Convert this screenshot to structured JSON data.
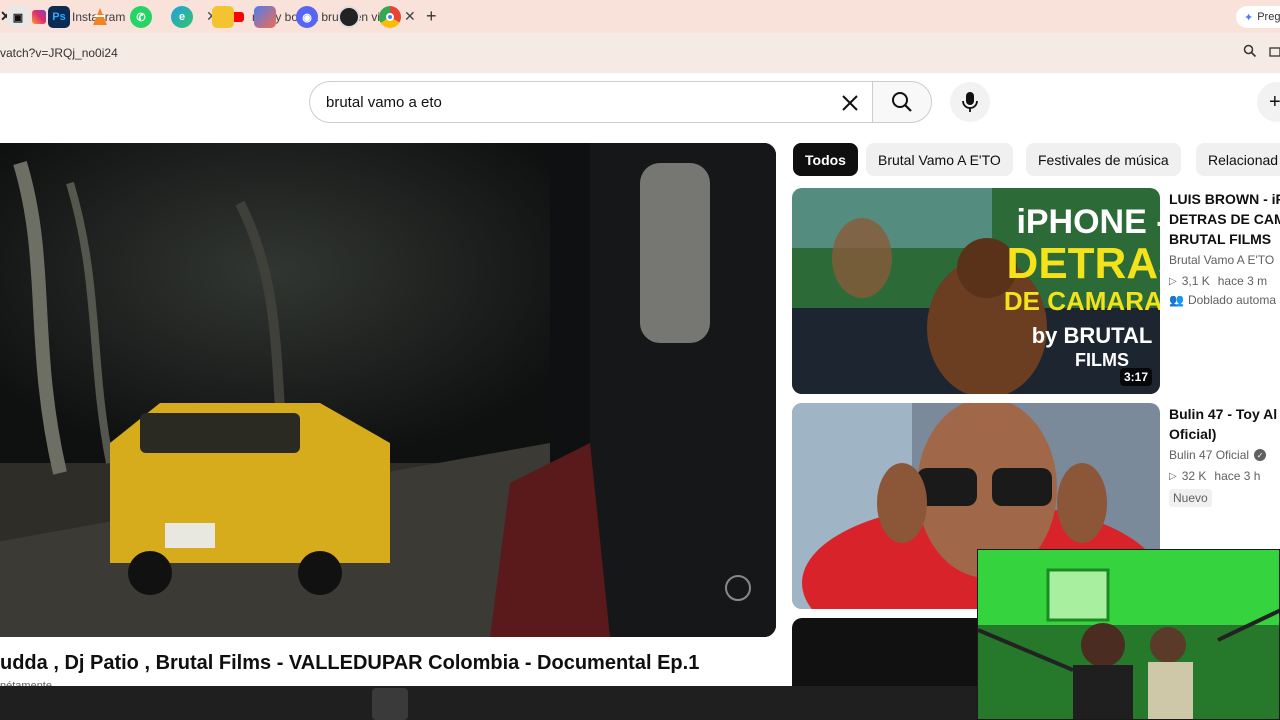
{
  "browser": {
    "tabs": [
      {
        "title": "(4) Instagram",
        "icon": "instagram-icon"
      },
      {
        "title": "rochy bota a brutal en vivo - Yo",
        "icon": "youtube-icon"
      }
    ],
    "url": "vatch?v=JRQj_no0i24",
    "gemini_label": "Preg"
  },
  "youtube": {
    "search_query": "brutal vamo a eto",
    "chips": [
      "Todos",
      "Brutal Vamo A E'TO",
      "Festivales de música",
      "Relacionad"
    ],
    "video": {
      "title": "udda , Dj Patio , Brutal Films - VALLEDUPAR Colombia - Documental Ep.1",
      "under_text": "nétamente"
    },
    "recommended": [
      {
        "title": "LUIS BROWN - iP DETRAS DE CAM BRUTAL FILMS",
        "channel": "Brutal Vamo A E'TO",
        "views": "3,1 K",
        "age": "hace 3 m",
        "extra": "Doblado automa",
        "duration": "3:17",
        "thumb_text": [
          "iPHONE -",
          "DETRAS",
          "DE CAMARAS",
          "by BRUTAL",
          "FILMS"
        ]
      },
      {
        "title": "Bulin 47 - Toy Al Oficial)",
        "channel": "Bulin 47 Oficial",
        "views": "32 K",
        "age": "hace 3 h",
        "extra": "Nuevo"
      }
    ]
  },
  "taskbar": {
    "icons": [
      "taskview-icon",
      "photoshop-icon",
      "vlc-icon",
      "whatsapp-icon",
      "edge-icon",
      "files-icon",
      "copilot-icon",
      "discord-icon",
      "obs-icon",
      "chrome-icon"
    ],
    "ps_label": "Ps"
  }
}
